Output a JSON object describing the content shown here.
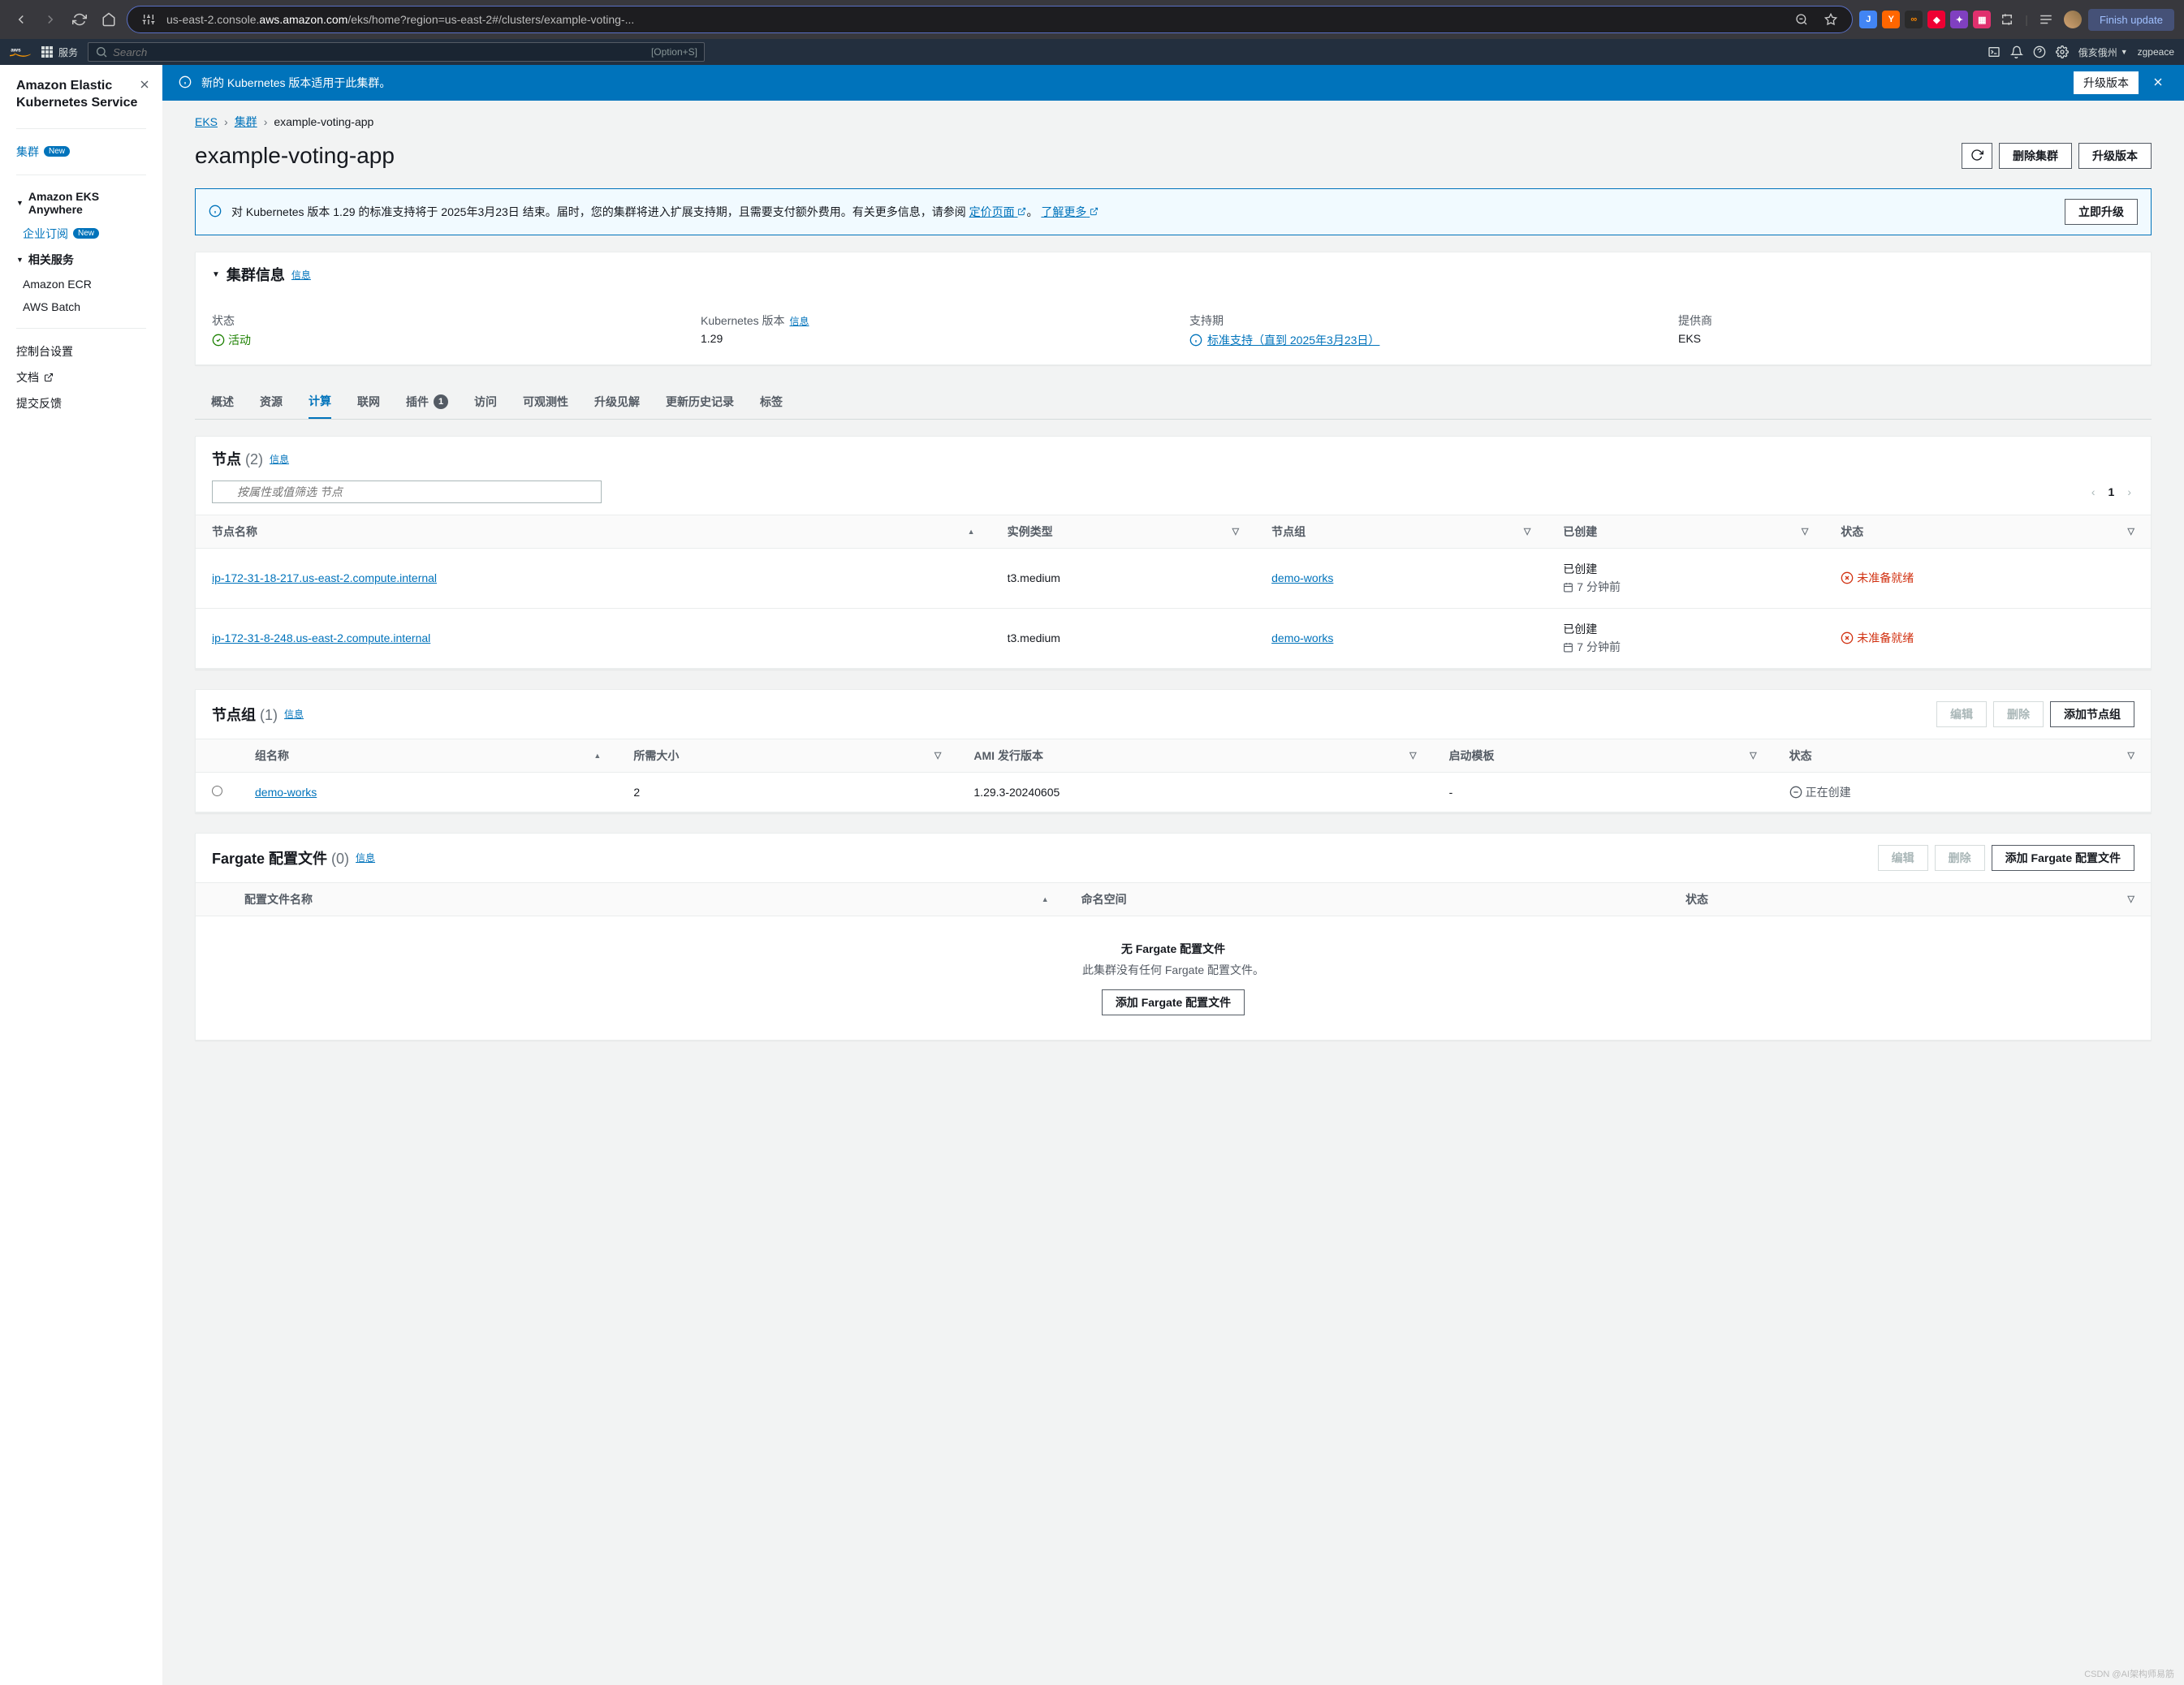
{
  "browser": {
    "url_prefix": "us-east-2.console.",
    "url_host": "aws.amazon.com",
    "url_path": "/eks/home?region=us-east-2#/clusters/example-voting-...",
    "finish_update": "Finish update"
  },
  "aws_header": {
    "services": "服务",
    "search_placeholder": "Search",
    "search_kbd": "[Option+S]",
    "region": "俄亥俄州",
    "user": "zgpeace"
  },
  "sidebar": {
    "title": "Amazon Elastic Kubernetes Service",
    "clusters": "集群",
    "new": "New",
    "anywhere": "Amazon EKS Anywhere",
    "enterprise": "企业订阅",
    "related": "相关服务",
    "ecr": "Amazon ECR",
    "batch": "AWS Batch",
    "console_settings": "控制台设置",
    "docs": "文档",
    "feedback": "提交反馈"
  },
  "banner": {
    "text": "新的 Kubernetes 版本适用于此集群。",
    "btn": "升级版本"
  },
  "breadcrumb": {
    "eks": "EKS",
    "clusters": "集群",
    "current": "example-voting-app"
  },
  "page": {
    "title": "example-voting-app",
    "refresh": "刷新",
    "delete": "删除集群",
    "upgrade": "升级版本"
  },
  "alert": {
    "text_pre": "对 Kubernetes 版本 1.29 的标准支持将于 2025年3月23日 结束。届时，您的集群将进入扩展支持期，且需要支付额外费用。有关更多信息，请参阅 ",
    "pricing": "定价页面",
    "sep": "。",
    "learn_more": "了解更多",
    "btn": "立即升级"
  },
  "cluster_info": {
    "title": "集群信息",
    "info": "信息",
    "status_label": "状态",
    "status_val": "活动",
    "version_label": "Kubernetes 版本",
    "version_info": "信息",
    "version_val": "1.29",
    "support_label": "支持期",
    "support_val": "标准支持（直到 2025年3月23日）",
    "provider_label": "提供商",
    "provider_val": "EKS"
  },
  "tabs": {
    "overview": "概述",
    "resources": "资源",
    "compute": "计算",
    "networking": "联网",
    "addons": "插件",
    "addons_count": "1",
    "access": "访问",
    "observability": "可观测性",
    "insights": "升级见解",
    "history": "更新历史记录",
    "tags": "标签"
  },
  "nodes": {
    "title": "节点",
    "count": "(2)",
    "info": "信息",
    "filter_placeholder": "按属性或值筛选 节点",
    "page": "1",
    "col_name": "节点名称",
    "col_type": "实例类型",
    "col_group": "节点组",
    "col_created": "已创建",
    "col_status": "状态",
    "rows": [
      {
        "name": "ip-172-31-18-217.us-east-2.compute.internal",
        "type": "t3.medium",
        "group": "demo-works",
        "created_l1": "已创建",
        "created_l2": "7 分钟前",
        "status": "未准备就绪"
      },
      {
        "name": "ip-172-31-8-248.us-east-2.compute.internal",
        "type": "t3.medium",
        "group": "demo-works",
        "created_l1": "已创建",
        "created_l2": "7 分钟前",
        "status": "未准备就绪"
      }
    ]
  },
  "nodegroups": {
    "title": "节点组",
    "count": "(1)",
    "info": "信息",
    "edit": "编辑",
    "delete": "删除",
    "add": "添加节点组",
    "col_name": "组名称",
    "col_size": "所需大小",
    "col_ami": "AMI 发行版本",
    "col_template": "启动模板",
    "col_status": "状态",
    "rows": [
      {
        "name": "demo-works",
        "size": "2",
        "ami": "1.29.3-20240605",
        "template": "-",
        "status": "正在创建"
      }
    ]
  },
  "fargate": {
    "title": "Fargate 配置文件",
    "count": "(0)",
    "info": "信息",
    "edit": "编辑",
    "delete": "删除",
    "add": "添加 Fargate 配置文件",
    "col_name": "配置文件名称",
    "col_ns": "命名空间",
    "col_status": "状态",
    "empty_title": "无 Fargate 配置文件",
    "empty_sub": "此集群没有任何 Fargate 配置文件。",
    "empty_btn": "添加 Fargate 配置文件"
  },
  "watermark": "CSDN @AI架构师易筋"
}
